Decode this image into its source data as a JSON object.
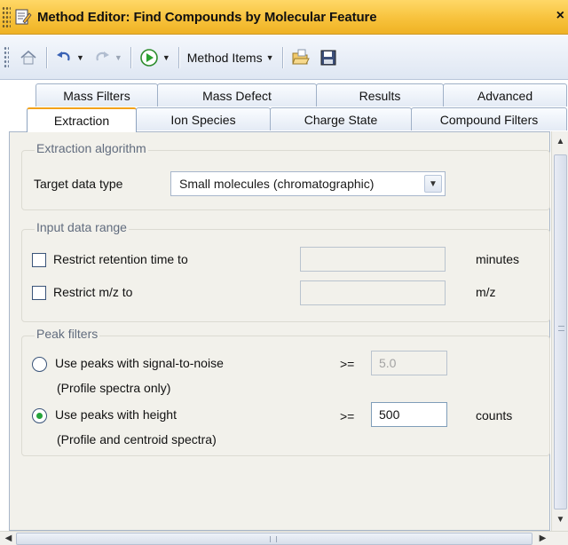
{
  "window": {
    "title": "Method Editor: Find Compounds by Molecular Feature",
    "close_glyph": "×"
  },
  "toolbar": {
    "home_icon": "home-icon",
    "undo_icon": "undo-icon",
    "redo_icon": "redo-icon",
    "run_icon": "run-icon",
    "menu_label": "Method Items",
    "open_icon": "open-icon",
    "save_icon": "save-icon"
  },
  "tabs_row1": [
    "Mass Filters",
    "Mass Defect",
    "Results",
    "Advanced"
  ],
  "tabs_row2": [
    "Extraction",
    "Ion Species",
    "Charge State",
    "Compound Filters"
  ],
  "active_tab": "Extraction",
  "extraction": {
    "title": "Extraction algorithm",
    "target_label": "Target data type",
    "target_value": "Small molecules (chromatographic)"
  },
  "input_range": {
    "title": "Input data range",
    "restrict_rt_label": "Restrict retention time to",
    "rt_value": "",
    "rt_unit": "minutes",
    "restrict_mz_label": "Restrict m/z to",
    "mz_value": "",
    "mz_unit": "m/z"
  },
  "peak_filters": {
    "title": "Peak filters",
    "snr_label": "Use peaks with signal-to-noise",
    "snr_note": "(Profile spectra only)",
    "snr_op": ">=",
    "snr_value": "5.0",
    "height_label": "Use peaks with height",
    "height_note": "(Profile and centroid spectra)",
    "height_op": ">=",
    "height_value": "500",
    "height_unit": "counts",
    "selected": "height"
  },
  "colors": {
    "title_bar": "#f7c23c",
    "active_tab_accent": "#f2a21b",
    "radio_dot": "#25a33a"
  }
}
